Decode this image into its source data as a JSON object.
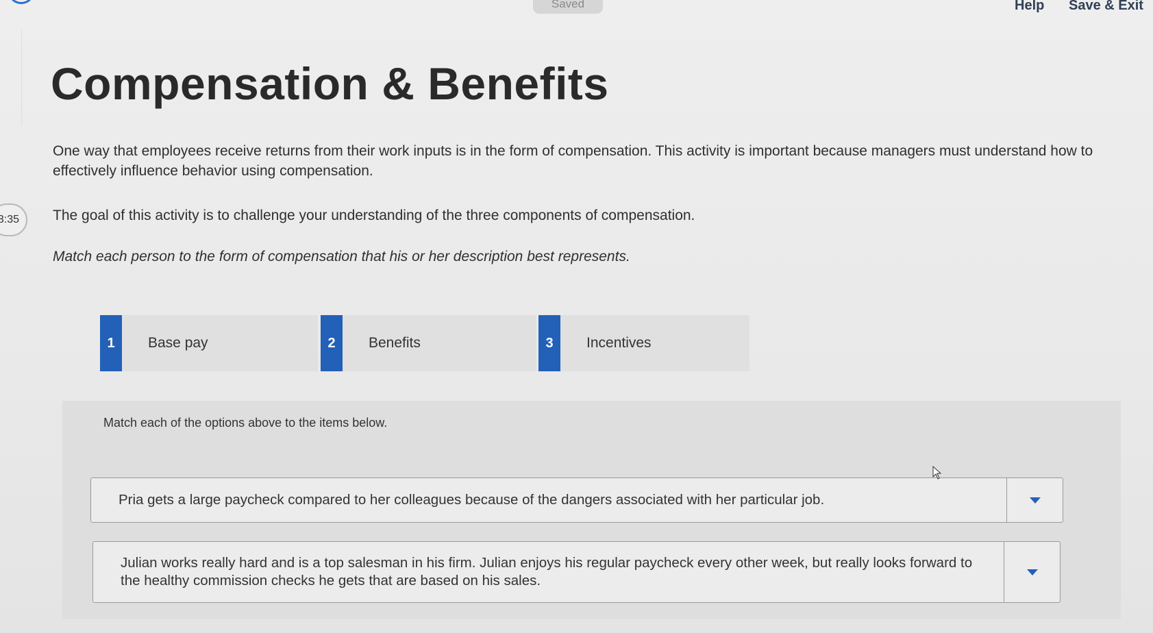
{
  "topbar": {
    "saved_label": "Saved",
    "help_label": "Help",
    "save_exit_label": "Save & Exit"
  },
  "timer": {
    "value": "3:35"
  },
  "heading": {
    "title": "Compensation & Benefits"
  },
  "intro": {
    "para1": "One way that employees receive returns from their work inputs is in the form of compensation. This activity is important because managers must understand how to effectively influence behavior using compensation.",
    "para2": "The goal of this activity is to challenge your understanding of the three components of compensation.",
    "para3": "Match each person to the form of compensation that his or her description best represents."
  },
  "options": [
    {
      "number": "1",
      "label": "Base pay"
    },
    {
      "number": "2",
      "label": "Benefits"
    },
    {
      "number": "3",
      "label": "Incentives"
    }
  ],
  "match": {
    "instruction": "Match each of the options above to the items below.",
    "items": [
      {
        "text": "Pria gets a large paycheck compared to her colleagues because of the dangers associated with her particular job."
      },
      {
        "text": "Julian works really hard and is a top salesman in his firm. Julian enjoys his regular paycheck every other week, but really looks forward to the healthy commission checks he gets that are based on his sales."
      }
    ]
  },
  "colors": {
    "accent": "#2360b8",
    "background": "#ececec",
    "panel": "#dedede"
  },
  "icons": {
    "dropdown": "caret-down-icon",
    "cursor": "mouse-pointer-icon"
  }
}
